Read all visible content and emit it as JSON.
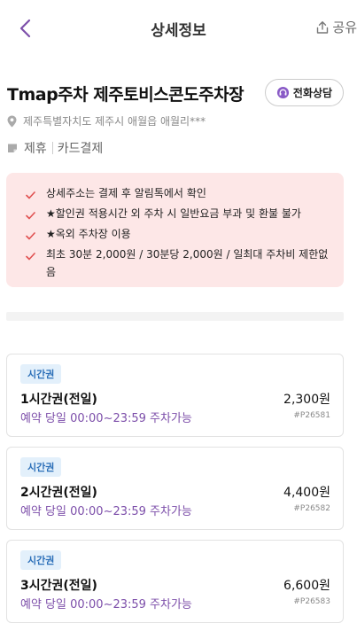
{
  "header": {
    "title": "상세정보",
    "share_label": "공유"
  },
  "lot": {
    "title": "Tmap주차 제주토비스콘도주차장",
    "call_label": "전화상담",
    "address": "제주특별자치도 제주시 애월읍 애월리***",
    "tags": [
      "제휴",
      "카드결제"
    ]
  },
  "notice": {
    "items": [
      "상세주소는 결제 후 알림톡에서 확인",
      "★할인권 적용시간 외 주차 시 일반요금 부과 및 환불 불가",
      "★옥외 주차장 이용",
      "최초 30분 2,000원 / 30분당 2,000원 / 일최대 주차비 제한없음"
    ]
  },
  "tickets": [
    {
      "badge": "시간권",
      "name": "1시간권(전일)",
      "availability": "예약 당일 00:00~23:59 주차가능",
      "price": "2,300원",
      "code": "#P26581"
    },
    {
      "badge": "시간권",
      "name": "2시간권(전일)",
      "availability": "예약 당일 00:00~23:59 주차가능",
      "price": "4,400원",
      "code": "#P26582"
    },
    {
      "badge": "시간권",
      "name": "3시간권(전일)",
      "availability": "예약 당일 00:00~23:59 주차가능",
      "price": "6,600원",
      "code": "#P26583"
    }
  ],
  "icons": {
    "back": "chevron-left-icon",
    "share": "share-icon",
    "call": "headset-icon",
    "location": "location-pin-icon",
    "card": "card-icon",
    "check": "check-icon"
  },
  "colors": {
    "accent_purple": "#7d4faa",
    "notice_bg": "#fde7e7",
    "check_red": "#e05050",
    "badge_bg": "#e3f0fb",
    "badge_text": "#2b6fb8"
  }
}
